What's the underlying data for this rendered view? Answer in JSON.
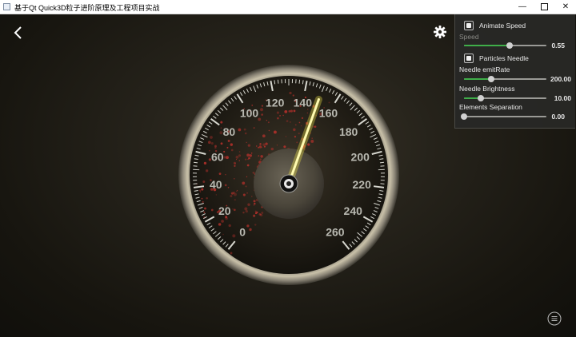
{
  "window": {
    "title": "基于Qt Quick3D粒子进阶原理及工程项目实战"
  },
  "icons": {
    "back": "back-arrow-icon",
    "settings": "gear-icon",
    "menu": "menu-icon"
  },
  "colors": {
    "accent": "#3fae49",
    "needle": "#f5e94a",
    "particles": "#b0302a"
  },
  "gauge": {
    "labels": [
      "0",
      "20",
      "40",
      "60",
      "80",
      "100",
      "120",
      "140",
      "160",
      "180",
      "200",
      "220",
      "240",
      "260"
    ],
    "min": 0,
    "max": 260,
    "current_value": 148
  },
  "settings": {
    "animate_speed": {
      "label": "Animate Speed",
      "checked": true
    },
    "speed": {
      "label": "Speed",
      "value": "0.55",
      "fraction": 0.55,
      "enabled": false
    },
    "particles_needle": {
      "label": "Particles Needle",
      "checked": true
    },
    "needle_emit_rate": {
      "label": "Needle emitRate",
      "value": "200.00",
      "fraction": 0.33
    },
    "needle_brightness": {
      "label": "Needle Brightness",
      "value": "10.00",
      "fraction": 0.2
    },
    "elements_separation": {
      "label": "Elements Separation",
      "value": "0.00",
      "fraction": 0.0
    }
  }
}
